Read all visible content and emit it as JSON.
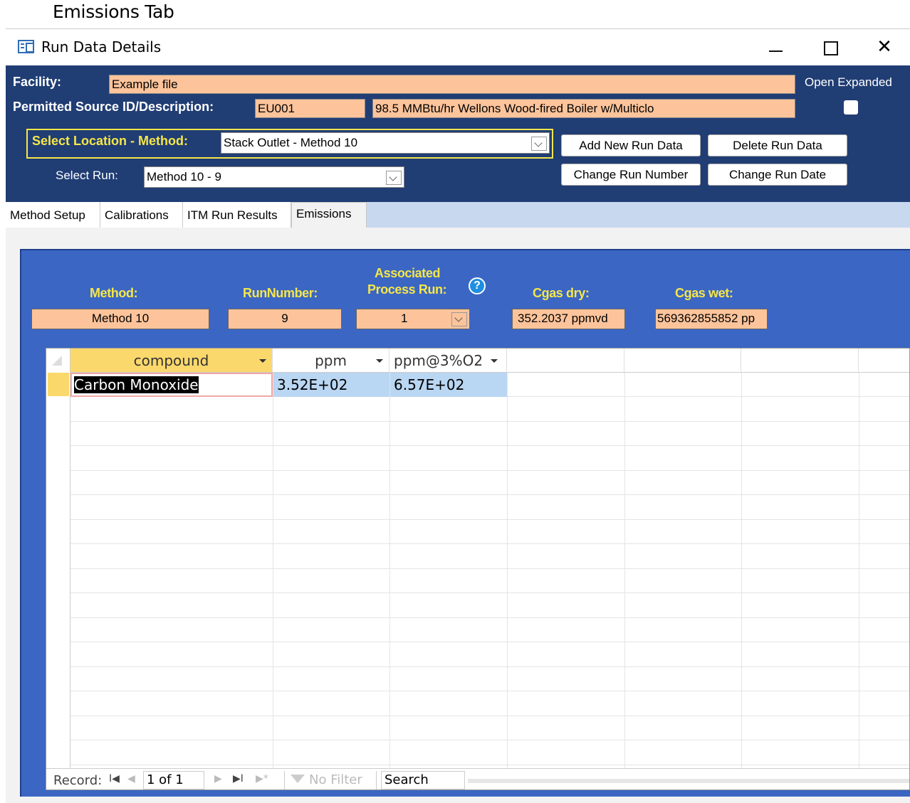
{
  "caption": "Emissions Tab",
  "window": {
    "title": "Run Data Details",
    "min_icon": "minimize-icon",
    "max_icon": "maximize-icon",
    "close_glyph": "✕"
  },
  "header": {
    "facility_label": "Facility:",
    "facility_value": "Example file",
    "source_label": "Permitted Source ID/Description:",
    "source_id": "EU001",
    "source_desc": "98.5 MMBtu/hr Wellons Wood-fired Boiler w/Multiclo",
    "open_expanded_label": "Open Expanded",
    "open_expanded_checked": false,
    "location_label": "Select Location - Method:",
    "location_value": "Stack Outlet - Method 10",
    "run_label": "Select Run:",
    "run_value": "Method 10 - 9",
    "buttons": {
      "add": "Add New Run Data",
      "delete": "Delete Run Data",
      "change_number": "Change Run Number",
      "change_date": "Change Run Date"
    }
  },
  "tabs": [
    "Method Setup",
    "Calibrations",
    "ITM Run Results",
    "Emissions"
  ],
  "active_tab": "Emissions",
  "subform": {
    "method_label": "Method:",
    "method_value": "Method 10",
    "runnumber_label": "RunNumber:",
    "runnumber_value": "9",
    "process_label_1": "Associated",
    "process_label_2": "Process Run:",
    "process_value": "1",
    "help_glyph": "?",
    "cgas_dry_label": "Cgas dry:",
    "cgas_dry_value": "352.2037 ppmvd",
    "cgas_wet_label": "Cgas wet:",
    "cgas_wet_value": "569362855852 pp"
  },
  "datasheet": {
    "columns": [
      "compound",
      "ppm",
      "ppm@3%O2"
    ],
    "rows": [
      {
        "compound": "Carbon Monoxide",
        "ppm": "3.52E+02",
        "ppm3": "6.57E+02"
      }
    ]
  },
  "navbar": {
    "record_label": "Record:",
    "first_glyph": "I◀",
    "prev_glyph": "◀",
    "position": "1 of 1",
    "next_glyph": "▶",
    "last_glyph": "▶I",
    "new_glyph": "▶*",
    "filter_label": "No Filter",
    "search_label": "Search"
  },
  "colors": {
    "header_bg": "#203d74",
    "field_bg": "#fdc49b",
    "subform_bg": "#3b66c3",
    "label_yellow": "#f5e64a",
    "selected_header": "#fbd86c",
    "cell_highlight": "#b9d6f2"
  }
}
